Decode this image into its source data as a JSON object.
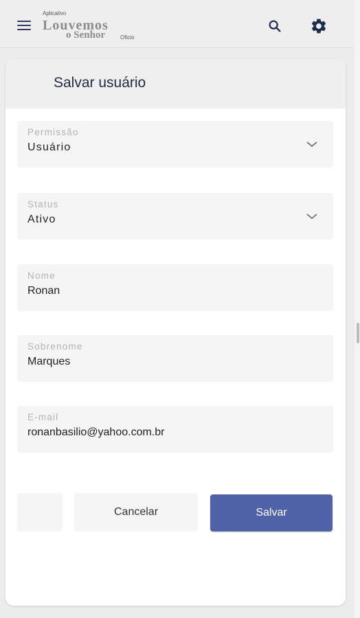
{
  "appbar": {
    "logo": {
      "top_text": "Aplicativo",
      "main_text": "Louvemos",
      "sub_text": "o Senhor",
      "bottom_text": "Oficio"
    },
    "icons": [
      "menu-icon",
      "search-icon",
      "gear-icon"
    ],
    "icon_color": "#1f2d4d"
  },
  "form": {
    "title": "Salvar usuário",
    "fields": [
      {
        "label": "Permissão",
        "value": "Usuário",
        "type": "select"
      },
      {
        "label": "Status",
        "value": "Ativo",
        "type": "select"
      },
      {
        "label": "Nome",
        "value": "Ronan",
        "type": "text"
      },
      {
        "label": "Sobrenome",
        "value": "Marques",
        "type": "text"
      },
      {
        "label": "E-mail",
        "value": "ronanbasilio@yahoo.com.br",
        "type": "text"
      }
    ],
    "buttons": {
      "cancel": "Cancelar",
      "save": "Salvar"
    },
    "accent_color": "#4f62a8"
  }
}
